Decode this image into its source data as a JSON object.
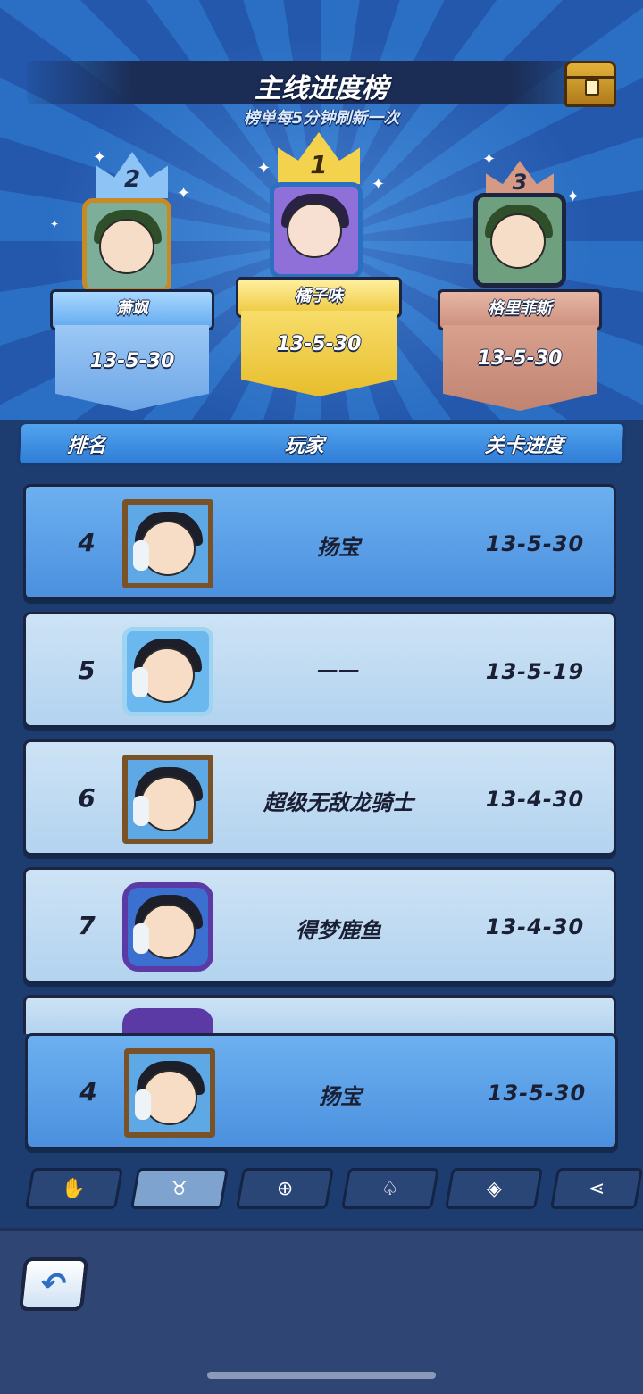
{
  "header": {
    "title": "主线进度榜",
    "subtitle": "榜单每5分钟刷新一次"
  },
  "podium": [
    {
      "rank": "2",
      "name": "萧飒",
      "progress": "13-5-30"
    },
    {
      "rank": "1",
      "name": "橘子味",
      "progress": "13-5-30"
    },
    {
      "rank": "3",
      "name": "格里菲斯",
      "progress": "13-5-30"
    }
  ],
  "columns": {
    "rank": "排名",
    "player": "玩家",
    "progress": "关卡进度"
  },
  "rows": [
    {
      "rank": "4",
      "name": "扬宝",
      "progress": "13-5-30",
      "frame": "wood",
      "highlight": true
    },
    {
      "rank": "5",
      "name": "——",
      "progress": "13-5-19",
      "frame": "ice",
      "highlight": false
    },
    {
      "rank": "6",
      "name": "超级无敌龙骑士",
      "progress": "13-4-30",
      "frame": "wood",
      "highlight": false
    },
    {
      "rank": "7",
      "name": "得梦鹿鱼",
      "progress": "13-4-30",
      "frame": "purple",
      "highlight": false
    }
  ],
  "my_rank": {
    "rank": "4",
    "name": "扬宝",
    "progress": "13-5-30"
  },
  "tabs": [
    {
      "icon": "hand-cards-icon",
      "glyph": "✋",
      "active": false
    },
    {
      "icon": "bull-icon",
      "glyph": "♉",
      "active": true
    },
    {
      "icon": "shield-icon",
      "glyph": "⊕",
      "active": false
    },
    {
      "icon": "cards-icon",
      "glyph": "♤",
      "active": false
    },
    {
      "icon": "gem-icon",
      "glyph": "◈",
      "active": false
    },
    {
      "icon": "share-icon",
      "glyph": "⋖",
      "active": false
    }
  ],
  "colors": {
    "gold": "#f3d34e",
    "silver": "#8ec4f5",
    "bronze": "#d69a84",
    "highlight_row": "#5ba0e6"
  }
}
